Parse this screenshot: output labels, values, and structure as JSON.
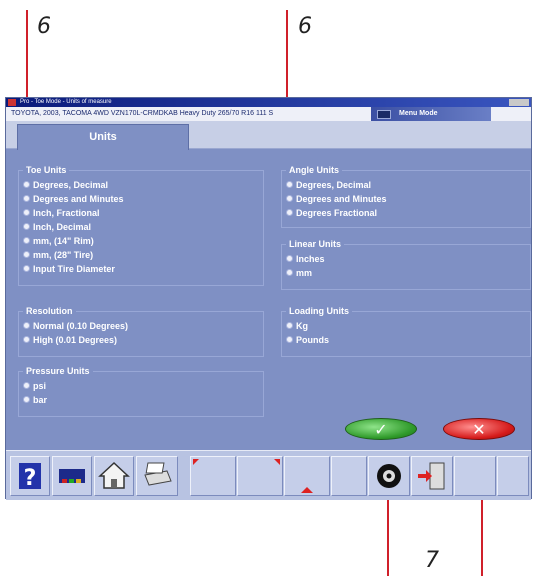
{
  "callouts": {
    "top_left": "6",
    "top_right": "6",
    "bottom": "7"
  },
  "window": {
    "title": "Pro - Toe Mode - Units of measure",
    "vehicle_info": "TOYOTA, 2003, TACOMA 4WD VZN170L-CRMDKAB Heavy Duty 265/70 R16 111 S",
    "menu_mode_label": "Menu Mode"
  },
  "tabs": [
    {
      "label": "Units"
    }
  ],
  "toe_units": {
    "title": "Toe Units",
    "options": [
      "Degrees, Decimal",
      "Degrees and Minutes",
      "Inch, Fractional",
      "Inch, Decimal",
      "mm, (14\" Rim)",
      "mm, (28\" Tire)",
      "Input Tire Diameter"
    ]
  },
  "angle_units": {
    "title": "Angle Units",
    "options": [
      "Degrees, Decimal",
      "Degrees and Minutes",
      "Degrees Fractional"
    ]
  },
  "linear_units": {
    "title": "Linear Units",
    "options": [
      "Inches",
      "mm"
    ]
  },
  "resolution": {
    "title": "Resolution",
    "options": [
      "Normal (0.10 Degrees)",
      "High (0.01 Degrees)"
    ]
  },
  "loading_units": {
    "title": "Loading Units",
    "options": [
      "Kg",
      "Pounds"
    ]
  },
  "pressure_units": {
    "title": "Pressure Units",
    "options": [
      "psi",
      "bar"
    ]
  },
  "buttons": {
    "ok_symbol": "✓",
    "cancel_symbol": "✕"
  },
  "toolbar_icons": [
    "help-icon",
    "vehicle-specs-icon",
    "home-icon",
    "print-icon",
    "softkey-1",
    "softkey-2",
    "softkey-3",
    "wheel-icon",
    "exit-door-icon",
    "softkey-4"
  ],
  "colors": {
    "window_bg": "#7f90c4",
    "ok_green": "#2f9a2a",
    "cancel_red": "#d51a1a",
    "callout_red": "#d0202a"
  }
}
